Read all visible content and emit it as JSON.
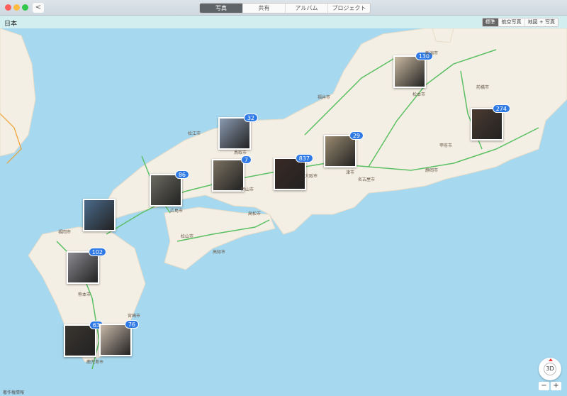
{
  "window": {
    "back_label": "<"
  },
  "tabs": [
    {
      "label": "写真",
      "active": true
    },
    {
      "label": "共有"
    },
    {
      "label": "アルバム"
    },
    {
      "label": "プロジェクト"
    }
  ],
  "header": {
    "region": "日本"
  },
  "map_modes": [
    {
      "label": "標準",
      "active": true
    },
    {
      "label": "航空写真"
    },
    {
      "label": "地図 + 写真"
    }
  ],
  "pins": [
    {
      "count": "130",
      "color": "#c9b9a0"
    },
    {
      "count": "274",
      "color": "#4a3a30"
    },
    {
      "count": "32",
      "color": "#8a9ab0"
    },
    {
      "count": "29",
      "color": "#9a8a70"
    },
    {
      "count": "86",
      "color": "#6b6a60"
    },
    {
      "count": "7",
      "color": "#7a7060"
    },
    {
      "count": "837",
      "color": "#3a2a25"
    },
    {
      "count": "",
      "color": "#4a6a8a"
    },
    {
      "count": "102",
      "color": "#8a8a90"
    },
    {
      "count": "63",
      "color": "#3a3530"
    },
    {
      "count": "76",
      "color": "#c8b8a8"
    }
  ],
  "cities": [
    "福井市",
    "名古屋市",
    "松本市",
    "前橋市",
    "鳥取市",
    "松江市",
    "広島市",
    "岡山市",
    "高松市",
    "松山市",
    "高知市",
    "福岡市",
    "熊本市",
    "宮崎市",
    "鹿児島市",
    "大阪市",
    "津市",
    "静岡市",
    "甲府市",
    "新潟市"
  ],
  "controls": {
    "compass_label": "3D",
    "zoom_out": "−",
    "zoom_in": "+"
  },
  "legal": "著作権情報",
  "colors": {
    "sea": "#a6d8ef",
    "land": "#f4efe4",
    "road": "#5cc063",
    "badge": "#2f7ae5"
  }
}
